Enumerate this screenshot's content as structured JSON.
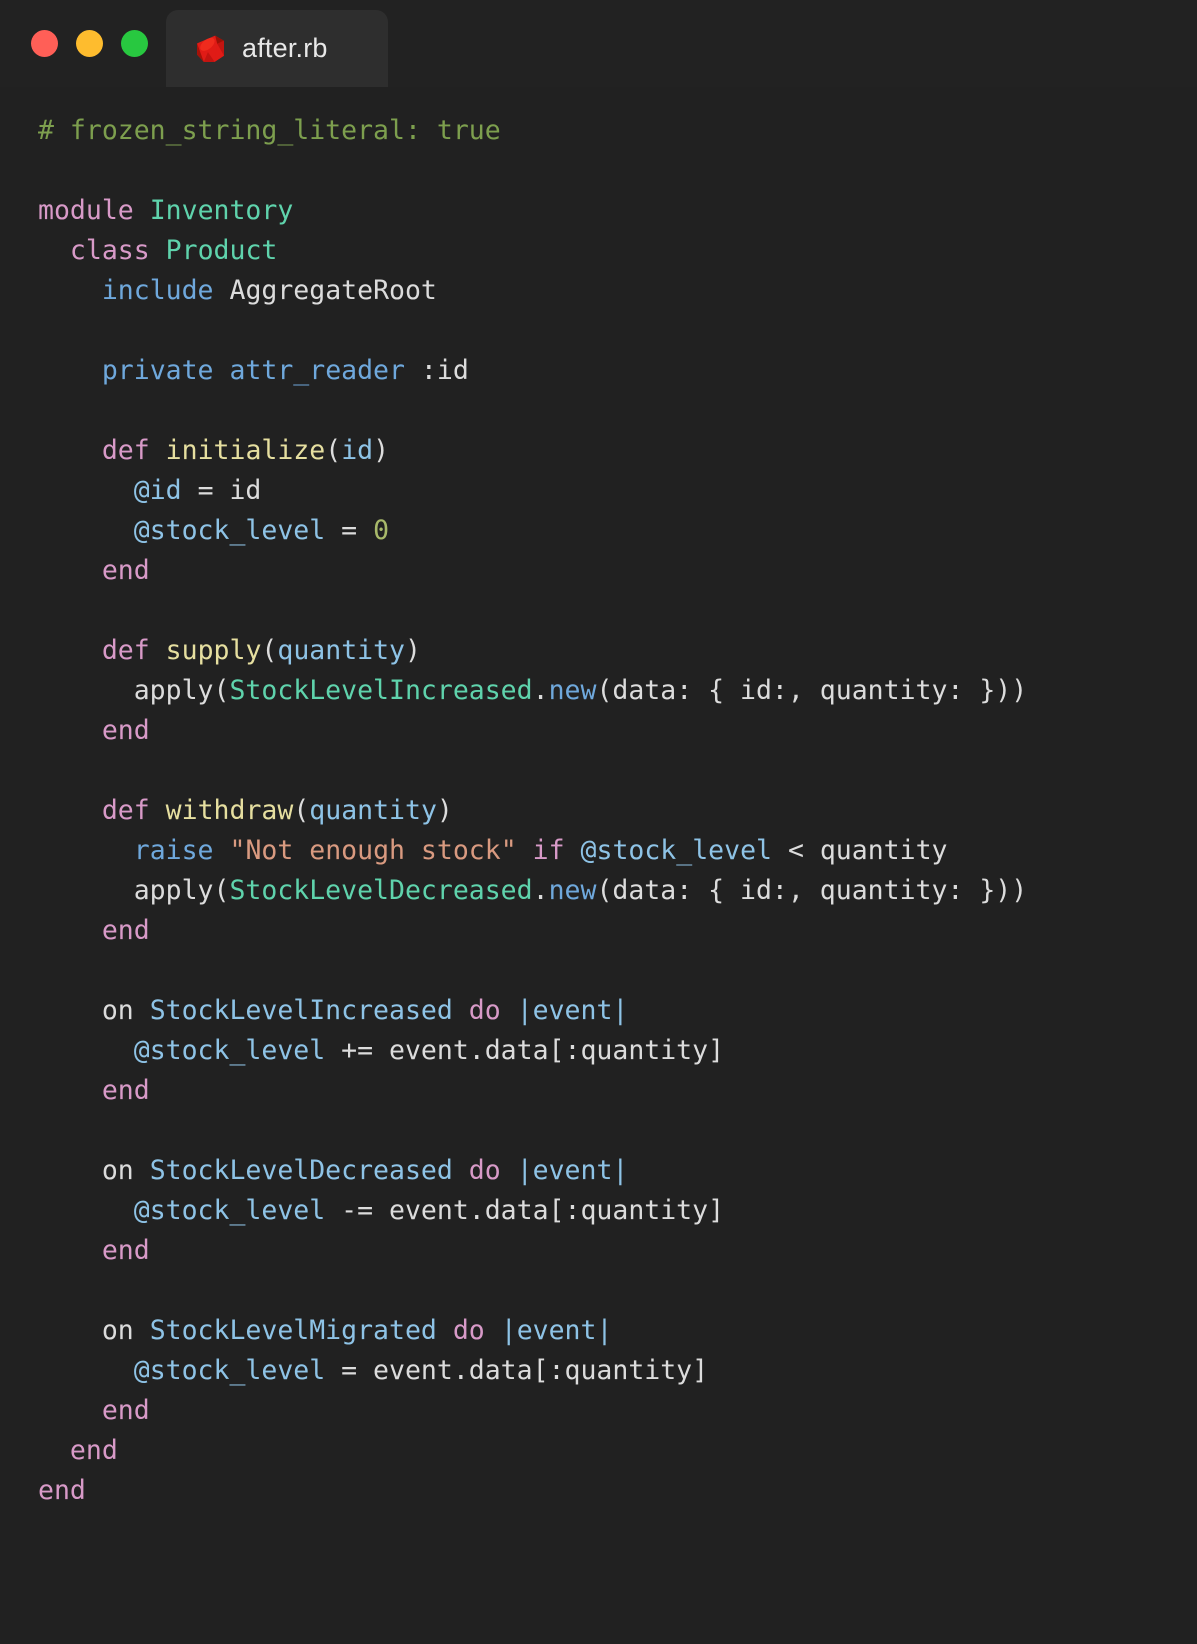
{
  "window": {
    "traffic_lights": [
      {
        "name": "close",
        "color": "#ff5f57"
      },
      {
        "name": "minimize",
        "color": "#febc2e"
      },
      {
        "name": "maximize",
        "color": "#28c840"
      }
    ]
  },
  "tab": {
    "label": "after.rb",
    "icon": "ruby-gem-icon",
    "icon_color": "#e01b16"
  },
  "theme": {
    "titlebar_bg": "#222222",
    "tab_bg": "#2e2e2e",
    "editor_bg": "#212121",
    "comment": "#7d9f4e",
    "keyword": "#d89ac8",
    "constant": "#5fd3ac",
    "constant_blue": "#8ec3e6",
    "function": "#e6dfa0",
    "ivar": "#8ec3e6",
    "method": "#6fa8dc",
    "plain": "#dcdcdc",
    "string": "#d99a80",
    "number": "#a8b96a"
  },
  "editor": {
    "language": "ruby",
    "filename": "after.rb",
    "plain_text": "# frozen_string_literal: true\n\nmodule Inventory\n  class Product\n    include AggregateRoot\n\n    private attr_reader :id\n\n    def initialize(id)\n      @id = id\n      @stock_level = 0\n    end\n\n    def supply(quantity)\n      apply(StockLevelIncreased.new(data: { id:, quantity: }))\n    end\n\n    def withdraw(quantity)\n      raise \"Not enough stock\" if @stock_level < quantity\n      apply(StockLevelDecreased.new(data: { id:, quantity: }))\n    end\n\n    on StockLevelIncreased do |event|\n      @stock_level += event.data[:quantity]\n    end\n\n    on StockLevelDecreased do |event|\n      @stock_level -= event.data[:quantity]\n    end\n\n    on StockLevelMigrated do |event|\n      @stock_level = event.data[:quantity]\n    end\n  end\nend",
    "lines": [
      {
        "n": 1,
        "tokens": [
          {
            "t": "# frozen_string_literal: true",
            "c": "comment"
          }
        ]
      },
      {
        "n": 2,
        "tokens": []
      },
      {
        "n": 3,
        "tokens": [
          {
            "t": "module",
            "c": "keyword"
          },
          {
            "t": " ",
            "c": "plain"
          },
          {
            "t": "Inventory",
            "c": "const"
          }
        ]
      },
      {
        "n": 4,
        "tokens": [
          {
            "t": "  ",
            "c": "plain"
          },
          {
            "t": "class",
            "c": "keyword"
          },
          {
            "t": " ",
            "c": "plain"
          },
          {
            "t": "Product",
            "c": "const"
          }
        ]
      },
      {
        "n": 5,
        "tokens": [
          {
            "t": "    ",
            "c": "plain"
          },
          {
            "t": "include",
            "c": "method"
          },
          {
            "t": " ",
            "c": "plain"
          },
          {
            "t": "AggregateRoot",
            "c": "plain"
          }
        ]
      },
      {
        "n": 6,
        "tokens": []
      },
      {
        "n": 7,
        "tokens": [
          {
            "t": "    ",
            "c": "plain"
          },
          {
            "t": "private attr_reader",
            "c": "method"
          },
          {
            "t": " :id",
            "c": "plain"
          }
        ]
      },
      {
        "n": 8,
        "tokens": []
      },
      {
        "n": 9,
        "tokens": [
          {
            "t": "    ",
            "c": "plain"
          },
          {
            "t": "def",
            "c": "keyword"
          },
          {
            "t": " ",
            "c": "plain"
          },
          {
            "t": "initialize",
            "c": "func"
          },
          {
            "t": "(",
            "c": "plain"
          },
          {
            "t": "id",
            "c": "param"
          },
          {
            "t": ")",
            "c": "plain"
          }
        ]
      },
      {
        "n": 10,
        "tokens": [
          {
            "t": "      ",
            "c": "plain"
          },
          {
            "t": "@id",
            "c": "ivar"
          },
          {
            "t": " = id",
            "c": "plain"
          }
        ]
      },
      {
        "n": 11,
        "tokens": [
          {
            "t": "      ",
            "c": "plain"
          },
          {
            "t": "@stock_level",
            "c": "ivar"
          },
          {
            "t": " = ",
            "c": "plain"
          },
          {
            "t": "0",
            "c": "number"
          }
        ]
      },
      {
        "n": 12,
        "tokens": [
          {
            "t": "    ",
            "c": "plain"
          },
          {
            "t": "end",
            "c": "keyword"
          }
        ]
      },
      {
        "n": 13,
        "tokens": []
      },
      {
        "n": 14,
        "tokens": [
          {
            "t": "    ",
            "c": "plain"
          },
          {
            "t": "def",
            "c": "keyword"
          },
          {
            "t": " ",
            "c": "plain"
          },
          {
            "t": "supply",
            "c": "func"
          },
          {
            "t": "(",
            "c": "plain"
          },
          {
            "t": "quantity",
            "c": "param"
          },
          {
            "t": ")",
            "c": "plain"
          }
        ]
      },
      {
        "n": 15,
        "tokens": [
          {
            "t": "      apply(",
            "c": "plain"
          },
          {
            "t": "StockLevelIncreased",
            "c": "const"
          },
          {
            "t": ".",
            "c": "plain"
          },
          {
            "t": "new",
            "c": "method"
          },
          {
            "t": "(data: { id:, quantity: }))",
            "c": "plain"
          }
        ]
      },
      {
        "n": 16,
        "tokens": [
          {
            "t": "    ",
            "c": "plain"
          },
          {
            "t": "end",
            "c": "keyword"
          }
        ]
      },
      {
        "n": 17,
        "tokens": []
      },
      {
        "n": 18,
        "tokens": [
          {
            "t": "    ",
            "c": "plain"
          },
          {
            "t": "def",
            "c": "keyword"
          },
          {
            "t": " ",
            "c": "plain"
          },
          {
            "t": "withdraw",
            "c": "func"
          },
          {
            "t": "(",
            "c": "plain"
          },
          {
            "t": "quantity",
            "c": "param"
          },
          {
            "t": ")",
            "c": "plain"
          }
        ]
      },
      {
        "n": 19,
        "tokens": [
          {
            "t": "      ",
            "c": "plain"
          },
          {
            "t": "raise",
            "c": "method"
          },
          {
            "t": " ",
            "c": "plain"
          },
          {
            "t": "\"Not enough stock\"",
            "c": "string"
          },
          {
            "t": " ",
            "c": "plain"
          },
          {
            "t": "if",
            "c": "keyword"
          },
          {
            "t": " ",
            "c": "plain"
          },
          {
            "t": "@stock_level",
            "c": "ivar"
          },
          {
            "t": " < quantity",
            "c": "plain"
          }
        ]
      },
      {
        "n": 20,
        "tokens": [
          {
            "t": "      apply(",
            "c": "plain"
          },
          {
            "t": "StockLevelDecreased",
            "c": "const"
          },
          {
            "t": ".",
            "c": "plain"
          },
          {
            "t": "new",
            "c": "method"
          },
          {
            "t": "(data: { id:, quantity: }))",
            "c": "plain"
          }
        ]
      },
      {
        "n": 21,
        "tokens": [
          {
            "t": "    ",
            "c": "plain"
          },
          {
            "t": "end",
            "c": "keyword"
          }
        ]
      },
      {
        "n": 22,
        "tokens": []
      },
      {
        "n": 23,
        "tokens": [
          {
            "t": "    on ",
            "c": "plain"
          },
          {
            "t": "StockLevelIncreased",
            "c": "constb"
          },
          {
            "t": " ",
            "c": "plain"
          },
          {
            "t": "do",
            "c": "keyword"
          },
          {
            "t": " ",
            "c": "plain"
          },
          {
            "t": "|event|",
            "c": "param"
          }
        ]
      },
      {
        "n": 24,
        "tokens": [
          {
            "t": "      ",
            "c": "plain"
          },
          {
            "t": "@stock_level",
            "c": "ivar"
          },
          {
            "t": " += event.data[:quantity]",
            "c": "plain"
          }
        ]
      },
      {
        "n": 25,
        "tokens": [
          {
            "t": "    ",
            "c": "plain"
          },
          {
            "t": "end",
            "c": "keyword"
          }
        ]
      },
      {
        "n": 26,
        "tokens": []
      },
      {
        "n": 27,
        "tokens": [
          {
            "t": "    on ",
            "c": "plain"
          },
          {
            "t": "StockLevelDecreased",
            "c": "constb"
          },
          {
            "t": " ",
            "c": "plain"
          },
          {
            "t": "do",
            "c": "keyword"
          },
          {
            "t": " ",
            "c": "plain"
          },
          {
            "t": "|event|",
            "c": "param"
          }
        ]
      },
      {
        "n": 28,
        "tokens": [
          {
            "t": "      ",
            "c": "plain"
          },
          {
            "t": "@stock_level",
            "c": "ivar"
          },
          {
            "t": " -= event.data[:quantity]",
            "c": "plain"
          }
        ]
      },
      {
        "n": 29,
        "tokens": [
          {
            "t": "    ",
            "c": "plain"
          },
          {
            "t": "end",
            "c": "keyword"
          }
        ]
      },
      {
        "n": 30,
        "tokens": []
      },
      {
        "n": 31,
        "tokens": [
          {
            "t": "    on ",
            "c": "plain"
          },
          {
            "t": "StockLevelMigrated",
            "c": "constb"
          },
          {
            "t": " ",
            "c": "plain"
          },
          {
            "t": "do",
            "c": "keyword"
          },
          {
            "t": " ",
            "c": "plain"
          },
          {
            "t": "|event|",
            "c": "param"
          }
        ]
      },
      {
        "n": 32,
        "tokens": [
          {
            "t": "      ",
            "c": "plain"
          },
          {
            "t": "@stock_level",
            "c": "ivar"
          },
          {
            "t": " = event.data[:quantity]",
            "c": "plain"
          }
        ]
      },
      {
        "n": 33,
        "tokens": [
          {
            "t": "    ",
            "c": "plain"
          },
          {
            "t": "end",
            "c": "keyword"
          }
        ]
      },
      {
        "n": 34,
        "tokens": [
          {
            "t": "  ",
            "c": "plain"
          },
          {
            "t": "end",
            "c": "keyword"
          }
        ]
      },
      {
        "n": 35,
        "tokens": [
          {
            "t": "end",
            "c": "keyword"
          }
        ]
      }
    ]
  }
}
